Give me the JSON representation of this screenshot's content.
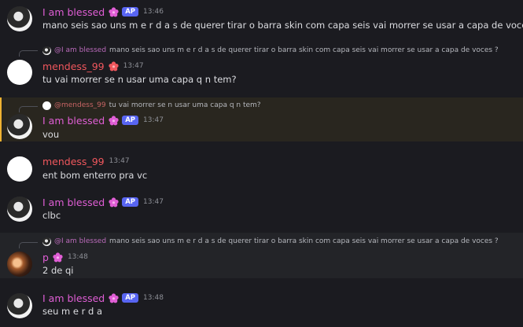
{
  "messages": [
    {
      "author": "I am blessed",
      "tag": "AP",
      "time": "13:46",
      "text": "mano seis sao uns m e r d a s de querer tirar o barra skin com capa seis vai morrer se usar a capa de voces ?"
    },
    {
      "reply_name": "@I am blessed",
      "reply_text": "mano seis sao uns m e r d a s de querer tirar o barra skin com capa seis vai morrer se usar a capa de voces ?",
      "author": "mendess_99",
      "time": "13:47",
      "text": "tu vai morrer se n usar uma capa q n tem?"
    },
    {
      "reply_name": "@mendess_99",
      "reply_text": "tu vai morrer se n usar uma capa q n tem?",
      "author": "I am blessed",
      "tag": "AP",
      "time": "13:47",
      "text": "vou"
    },
    {
      "author": "mendess_99",
      "time": "13:47",
      "text": "ent bom enterro pra vc"
    },
    {
      "author": "I am blessed",
      "tag": "AP",
      "time": "13:47",
      "text": "clbc"
    },
    {
      "reply_name": "@I am blessed",
      "reply_text": "mano seis sao uns m e r d a s de querer tirar o barra skin com capa seis vai morrer se usar a capa de voces ?",
      "author": "p",
      "time": "13:48",
      "text": "2 de qi"
    },
    {
      "author": "I am blessed",
      "tag": "AP",
      "time": "13:48",
      "text": "seu m e r d a"
    }
  ],
  "colors": {
    "background": "#1b1b20",
    "pink_name": "#e05ed5",
    "red_name": "#f0575d",
    "tag_bg": "#5865f2",
    "mention_bar": "#f0b232"
  },
  "icons": {
    "badge": "flower-badge-icon"
  }
}
